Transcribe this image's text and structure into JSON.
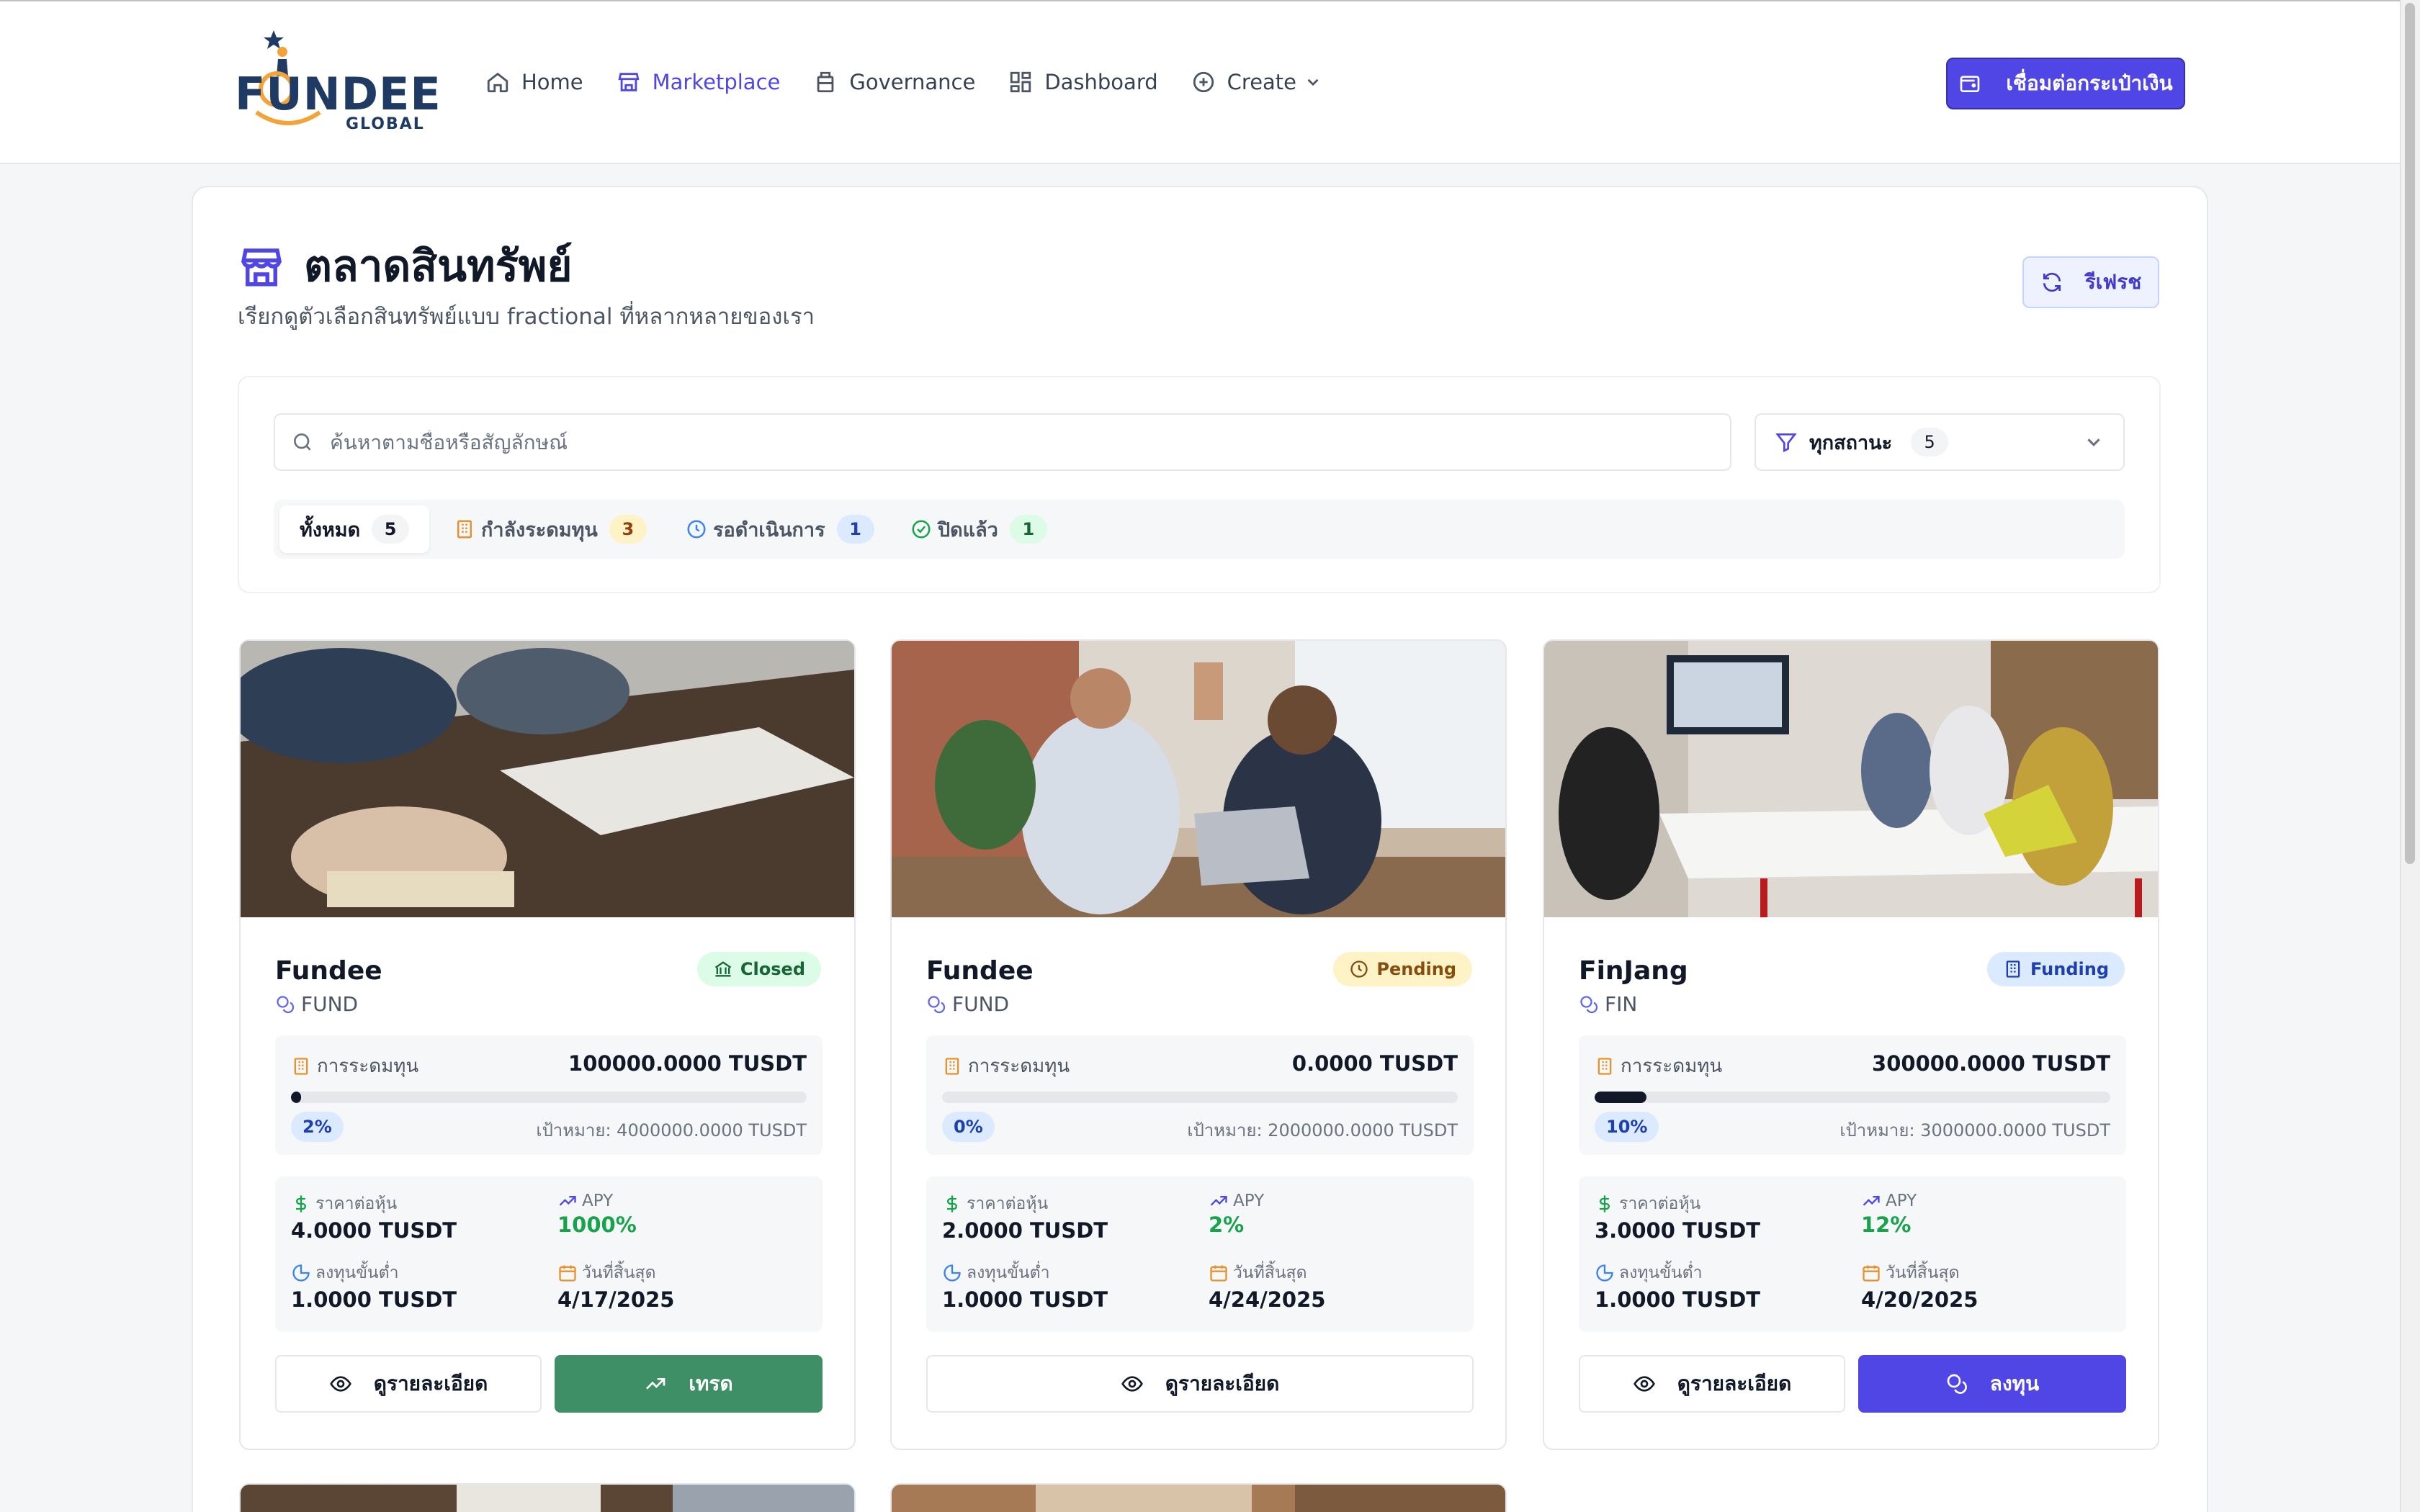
{
  "header": {
    "logo_text": "FUNDEE",
    "logo_sub": "GLOBAL",
    "nav": [
      {
        "label": "Home",
        "icon": "home-icon"
      },
      {
        "label": "Marketplace",
        "icon": "store-icon"
      },
      {
        "label": "Governance",
        "icon": "governance-icon"
      },
      {
        "label": "Dashboard",
        "icon": "dashboard-icon"
      },
      {
        "label": "Create",
        "icon": "plus-circle-icon"
      }
    ],
    "connect_wallet": "เชื่อมต่อกระเป๋าเงิน"
  },
  "page": {
    "title": "ตลาดสินทรัพย์",
    "subtitle": "เรียกดูตัวเลือกสินทรัพย์แบบ fractional ที่หลากหลายของเรา",
    "refresh": "รีเฟรช"
  },
  "filters": {
    "search_placeholder": "ค้นหาตามชื่อหรือสัญลักษณ์",
    "search_value": "",
    "status_label": "ทุกสถานะ",
    "status_count": "5",
    "tabs": [
      {
        "label": "ทั้งหมด",
        "count": "5"
      },
      {
        "label": "กำลังระดมทุน",
        "count": "3"
      },
      {
        "label": "รอดำเนินการ",
        "count": "1"
      },
      {
        "label": "ปิดแล้ว",
        "count": "1"
      }
    ]
  },
  "labels": {
    "fundraising": "การระดมทุน",
    "target_prefix": "เป้าหมาย:",
    "price_per_share": "ราคาต่อหุ้น",
    "apy": "APY",
    "min_invest": "ลงทุนขั้นต่ำ",
    "end_date": "วันที่สิ้นสุด",
    "view_details": "ดูรายละเอียด",
    "trade": "เทรด",
    "invest": "ลงทุน"
  },
  "assets": [
    {
      "name": "Fundee",
      "symbol": "FUND",
      "status": "Closed",
      "raised": "100000.0000 TUSDT",
      "progress_pct": 2,
      "progress_label": "2%",
      "target": "เป้าหมาย: 4000000.0000 TUSDT",
      "price": "4.0000 TUSDT",
      "apy": "1000%",
      "min_invest": "1.0000 TUSDT",
      "end_date": "4/17/2025"
    },
    {
      "name": "Fundee",
      "symbol": "FUND",
      "status": "Pending",
      "raised": "0.0000 TUSDT",
      "progress_pct": 0,
      "progress_label": "0%",
      "target": "เป้าหมาย: 2000000.0000 TUSDT",
      "price": "2.0000 TUSDT",
      "apy": "2%",
      "min_invest": "1.0000 TUSDT",
      "end_date": "4/24/2025"
    },
    {
      "name": "FinJang",
      "symbol": "FIN",
      "status": "Funding",
      "raised": "300000.0000 TUSDT",
      "progress_pct": 10,
      "progress_label": "10%",
      "target": "เป้าหมาย: 3000000.0000 TUSDT",
      "price": "3.0000 TUSDT",
      "apy": "12%",
      "min_invest": "1.0000 TUSDT",
      "end_date": "4/20/2025"
    }
  ],
  "colors": {
    "accent": "#4f46e5",
    "trade_green": "#3f8f66",
    "apy_green": "#16a34a"
  }
}
